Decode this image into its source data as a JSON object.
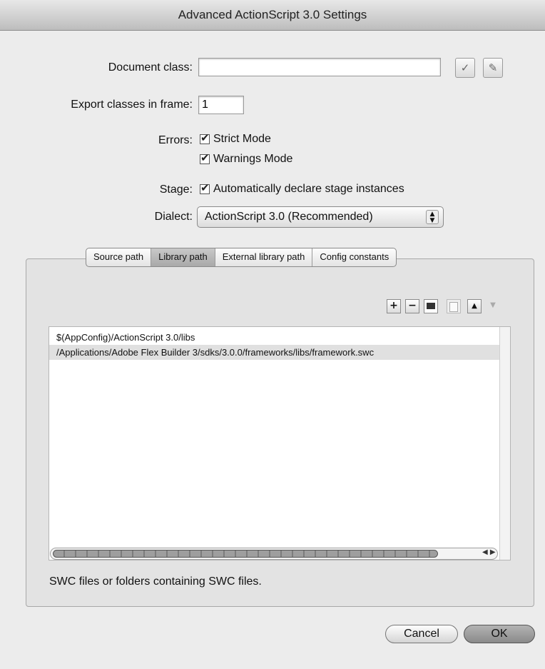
{
  "window": {
    "title": "Advanced ActionScript 3.0 Settings"
  },
  "document_class": {
    "label": "Document class:",
    "value": ""
  },
  "icons": {
    "check": "check-icon",
    "edit": "pencil-icon"
  },
  "export_frame": {
    "label": "Export classes in frame:",
    "value": "1"
  },
  "errors": {
    "label": "Errors:",
    "strict_mode": "Strict Mode",
    "warnings_mode": "Warnings Mode"
  },
  "stage": {
    "label": "Stage:",
    "auto_declare": "Automatically declare stage instances"
  },
  "dialect": {
    "label": "Dialect:",
    "selected": "ActionScript 3.0 (Recommended)"
  },
  "tabs": [
    "Source path",
    "Library path",
    "External library path",
    "Config constants"
  ],
  "toolbar": {
    "add": "+",
    "remove": "−"
  },
  "library_paths": [
    "$(AppConfig)/ActionScript 3.0/libs",
    "/Applications/Adobe Flex Builder 3/sdks/3.0.0/frameworks/libs/framework.swc"
  ],
  "hint": "SWC files or folders containing SWC files.",
  "buttons": {
    "cancel": "Cancel",
    "ok": "OK"
  }
}
